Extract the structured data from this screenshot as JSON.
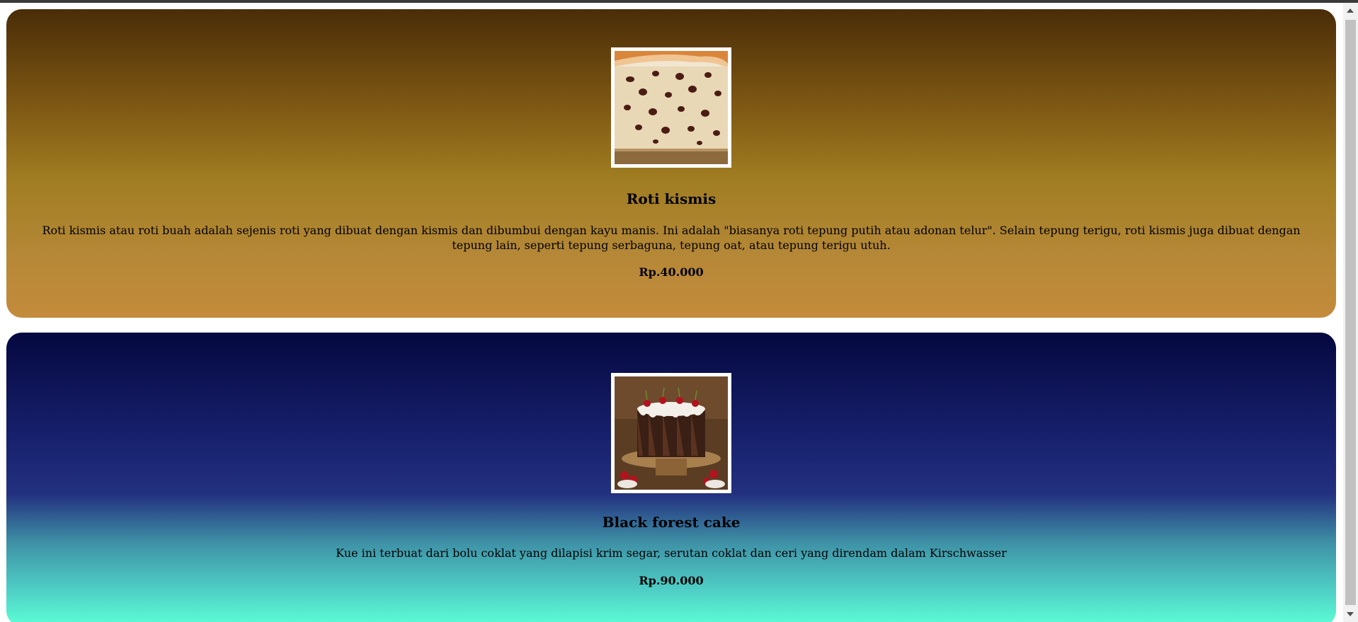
{
  "products": [
    {
      "title": "Roti kismis",
      "description": "Roti kismis atau roti buah adalah sejenis roti yang dibuat dengan kismis dan dibumbui dengan kayu manis. Ini adalah \"biasanya roti tepung putih atau adonan telur\". Selain tepung terigu, roti kismis juga dibuat dengan tepung lain, seperti tepung serbaguna, tepung oat, atau tepung terigu utuh.",
      "price": "Rp.40.000",
      "image": "raisin-bread-photo",
      "gradient": [
        "#4a2d08",
        "#a07d22",
        "#c48b3c"
      ]
    },
    {
      "title": "Black forest cake",
      "description": "Kue ini terbuat dari bolu coklat yang dilapisi krim segar, serutan coklat dan ceri yang direndam dalam Kirschwasser",
      "price": "Rp.90.000",
      "image": "black-forest-cake-photo",
      "gradient": [
        "#05083f",
        "#233180",
        "#5cffd5"
      ]
    }
  ],
  "scrollbar": {
    "up_icon": "arrow-up-icon",
    "down_icon": "arrow-down-icon"
  }
}
